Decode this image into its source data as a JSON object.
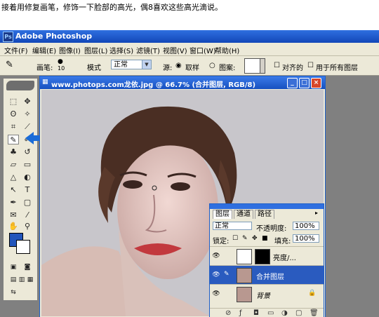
{
  "caption": "接着用修复画笔，修饰一下脸部的高光，偶8喜欢这些高光滴说。",
  "app": {
    "title": "Adobe Photoshop",
    "menu": [
      "文件(F)",
      "编辑(E)",
      "图像(I)",
      "图层(L)",
      "选择(S)",
      "滤镜(T)",
      "视图(V)",
      "窗口(W)",
      "帮助(H)"
    ]
  },
  "options": {
    "brush_label": "画笔:",
    "brush_size": "10",
    "mode_label": "模式",
    "mode_value": "正常",
    "source_label": "源:",
    "sampled_label": "取样",
    "pattern_label": "图案:",
    "aligned_label": "对齐的",
    "all_layers_label": "用于所有图层"
  },
  "document": {
    "title": "www.photops.com龙依.jpg @ 66.7% (合并图层, RGB/8)"
  },
  "layers_panel": {
    "tabs": [
      "图层",
      "通道",
      "路径"
    ],
    "blend_mode": "正常",
    "opacity_label": "不透明度:",
    "opacity_value": "100%",
    "lock_label": "锁定:",
    "fill_label": "填充:",
    "fill_value": "100%",
    "layers": [
      {
        "name": "亮度/...",
        "visible": true,
        "selected": false
      },
      {
        "name": "合并图层",
        "visible": true,
        "selected": true
      },
      {
        "name": "背景",
        "visible": true,
        "selected": false
      }
    ]
  },
  "colors": {
    "foreground": "#2255bb",
    "background": "#ffffff",
    "accent": "#2f6fe0"
  }
}
